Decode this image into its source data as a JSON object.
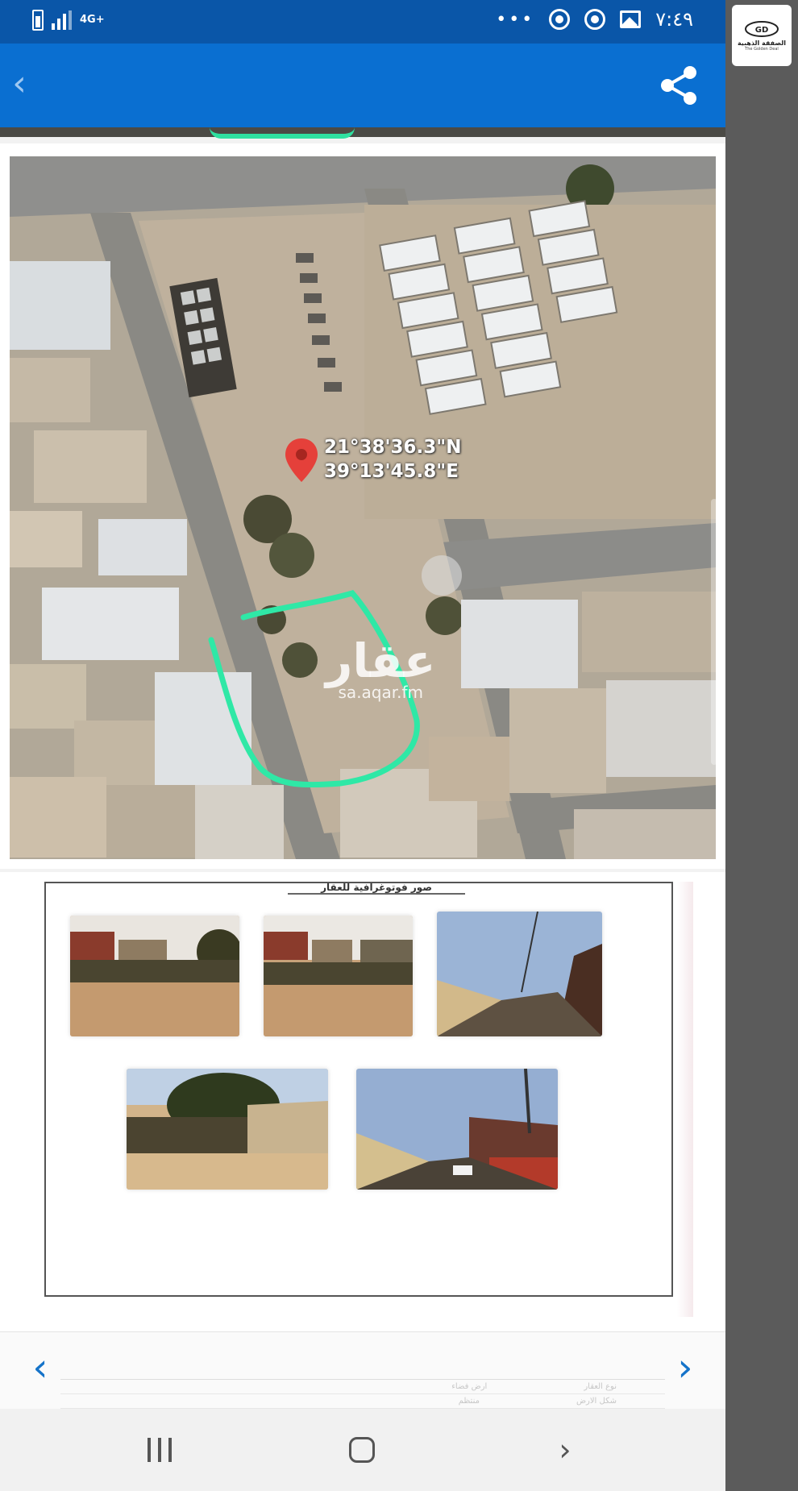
{
  "status_bar": {
    "network": "4G+",
    "clock": "٧:٤٩",
    "overflow": "•••",
    "icons": [
      "battery-icon",
      "signal-icon",
      "chrome-icon",
      "chrome-icon",
      "gallery-icon"
    ]
  },
  "app_bar": {
    "back_icon": "chevron-left-icon",
    "share_icon": "share-icon",
    "color": "#0a6fd1"
  },
  "map": {
    "lat": "21°38'36.3\"N",
    "lon": "39°13'45.8\"E",
    "pin_icon": "map-pin-icon",
    "outline_color": "#2fe8a6",
    "watermark": "عقار",
    "watermark_sub": "sa.aqar.fm"
  },
  "document": {
    "title": "صور فوتوغرافية للعقار",
    "photos": 5
  },
  "pager": {
    "prev_icon": "chevron-left-icon",
    "next_icon": "chevron-right-icon",
    "table_rows": [
      {
        "label": "نوع العقار",
        "value": "ارض فضاء"
      },
      {
        "label": "شكل الارض",
        "value": "منتظم"
      }
    ]
  },
  "nav_bar": {
    "recents_icon": "recents-icon",
    "home_icon": "home-icon",
    "back_icon": "back-icon"
  },
  "brand": {
    "name_ar": "الصفقة الذهبية",
    "name_en": "The Golden Deal",
    "logo_letters": "GD"
  }
}
